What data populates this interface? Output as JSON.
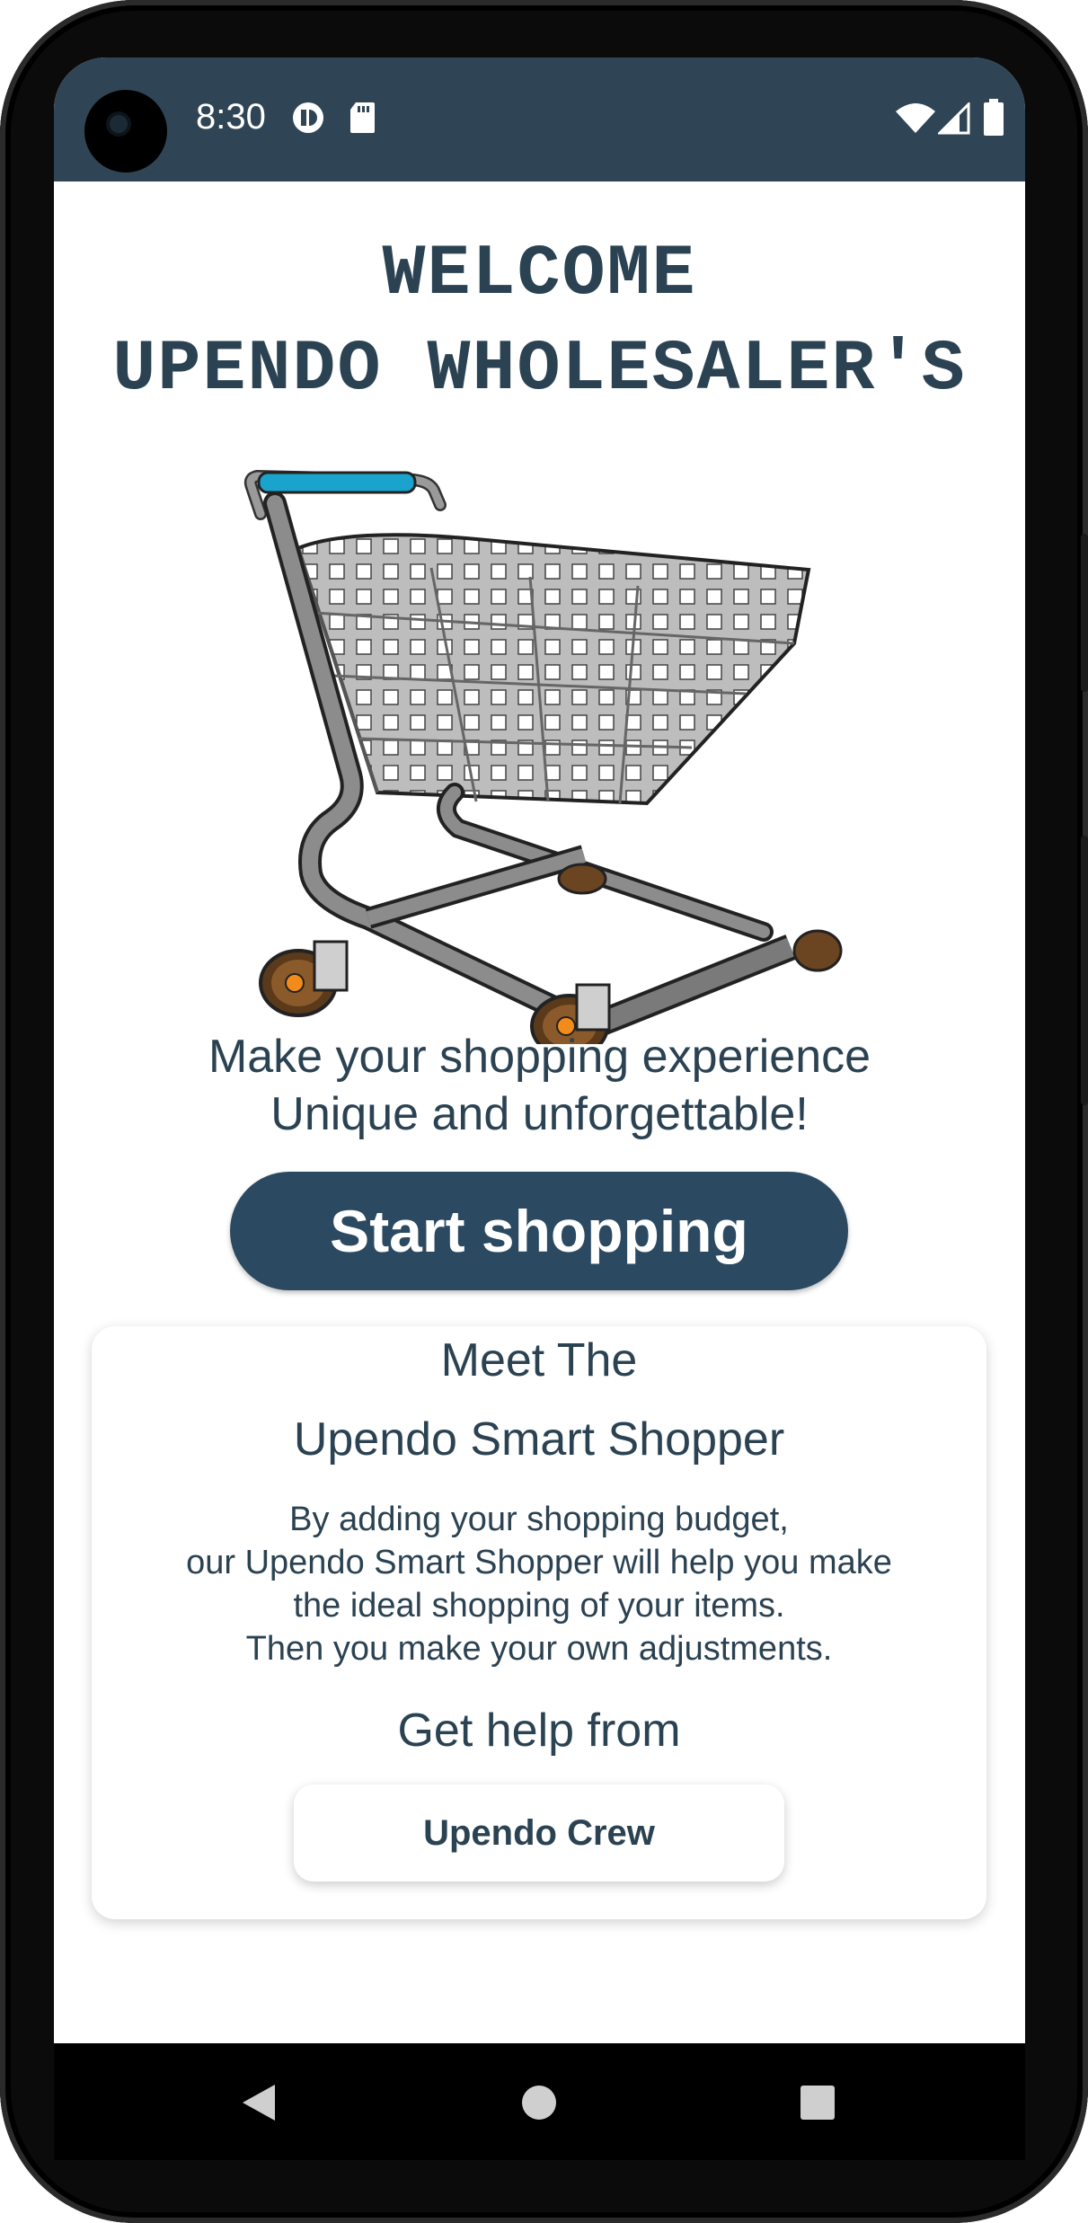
{
  "status_bar": {
    "time": "8:30",
    "left_icons": [
      "cast-icon",
      "sd-card-icon"
    ],
    "right_icons": [
      "wifi-icon",
      "signal-icon",
      "battery-icon"
    ],
    "background": "#2f4555"
  },
  "header": {
    "line1": "WELCOME",
    "line2": "UPENDO WHOLESALER'S"
  },
  "hero_image": "shopping-cart",
  "tagline": {
    "line1": "Make your shopping experience",
    "line2": "Unique and unforgettable!"
  },
  "start_button": {
    "label": "Start shopping",
    "color": "#2b4a62"
  },
  "smart_shopper_card": {
    "title_line1": "Meet The",
    "title_line2": "Upendo Smart Shopper",
    "description": [
      "By adding your shopping budget,",
      "our Upendo Smart Shopper will help you make",
      "the ideal shopping of your items.",
      "Then you make your own adjustments."
    ],
    "help_label": "Get help from",
    "crew_button_label": "Upendo Crew"
  },
  "nav_bar": {
    "icons": [
      "back-icon",
      "home-icon",
      "recents-icon"
    ]
  }
}
